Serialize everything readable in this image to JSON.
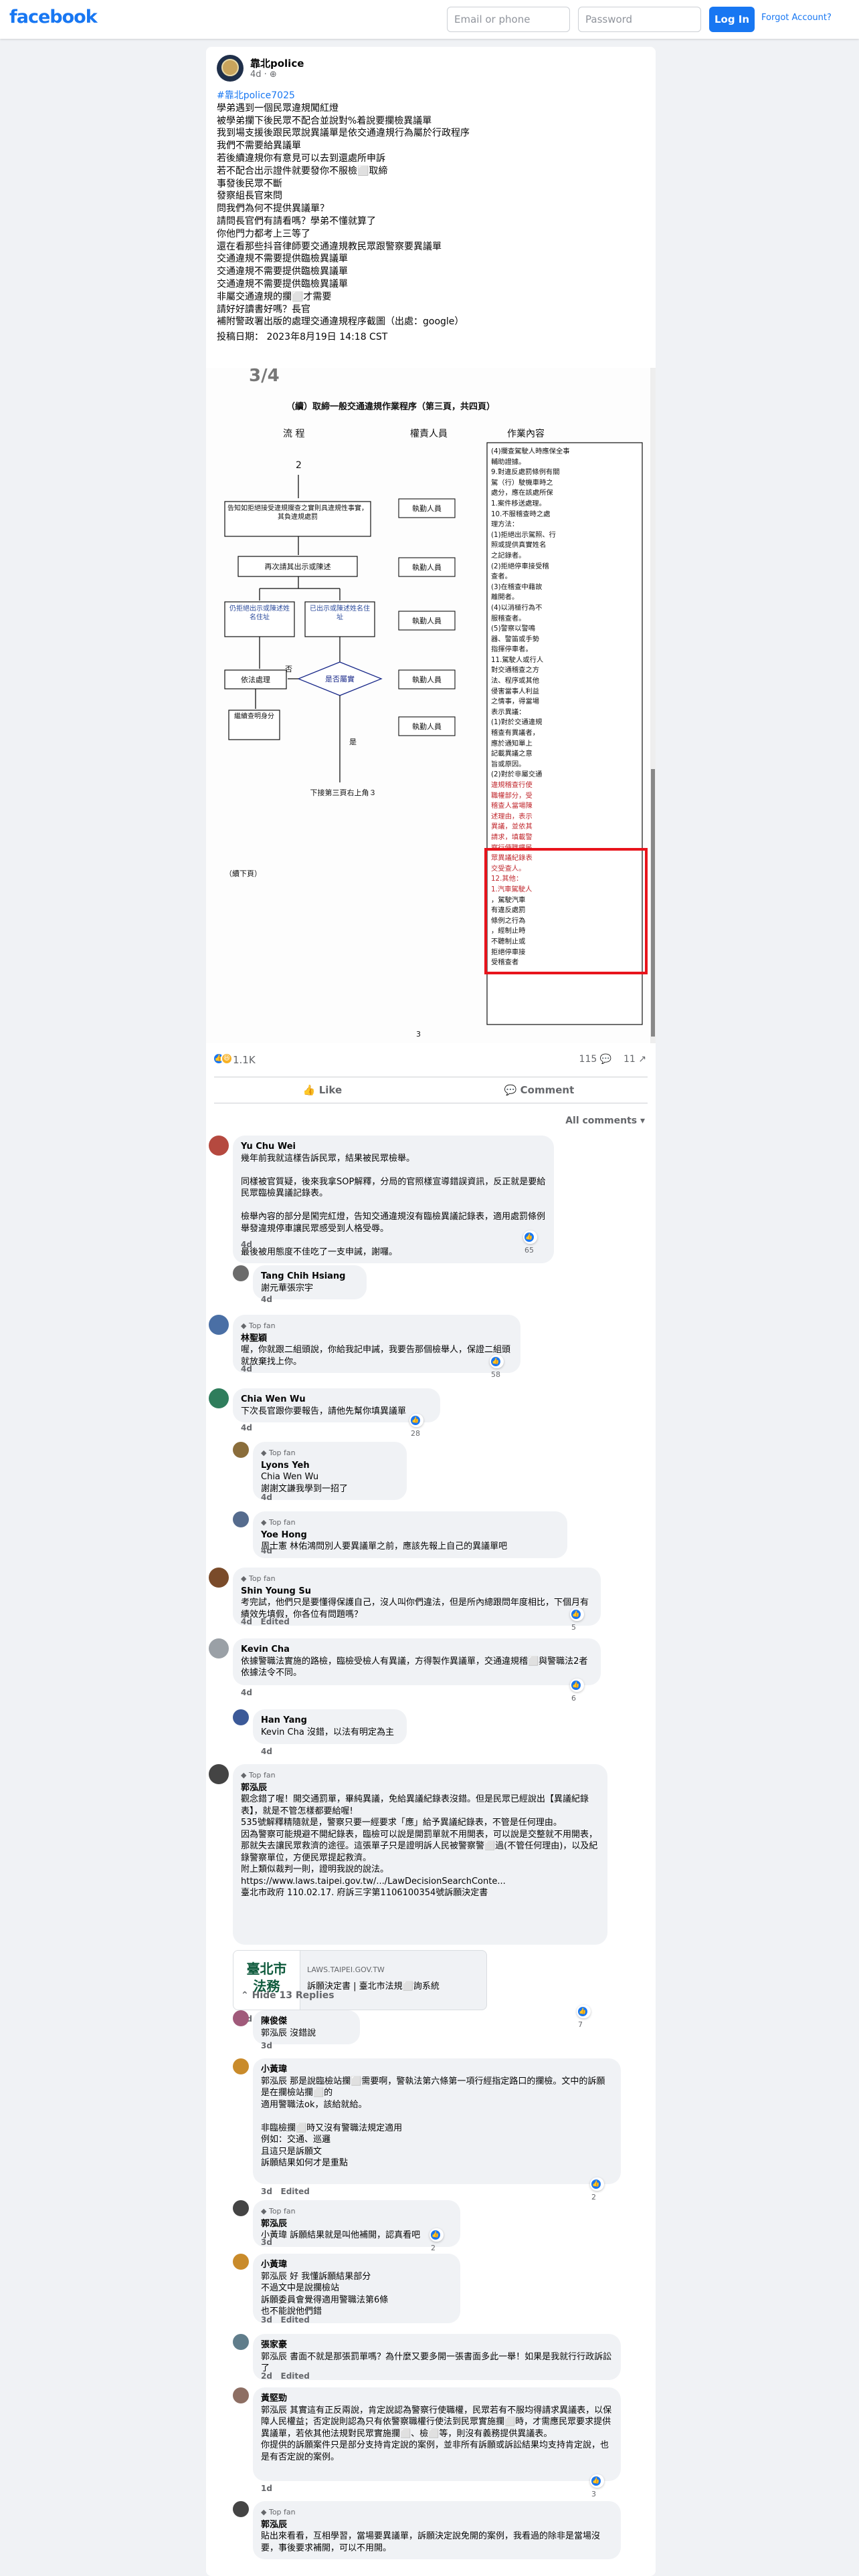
{
  "topbar": {
    "logo": "facebook",
    "email_placeholder": "Email or phone",
    "password_placeholder": "Password",
    "login_label": "Log In",
    "forgot_label": "Forgot Account?"
  },
  "post": {
    "author": "靠北police",
    "meta": "4d · ⊕",
    "hashtag": "#靠北police7025",
    "body": "學弟遇到一個民眾違規闖紅燈\n被學弟攔下後民眾不配合並說對%着說要攔檢異議單\n我到場支援後跟民眾說異議單是依交通違規行為屬於行政程序\n我們不需要給異議單\n若後續違規你有意見可以去到還處所申訴\n若不配合出示證件就要發你不服檢⬜取締\n事發後民眾不斷\n發察組長官來問\n問我們為何不提供異議單？\n請問長官們有請看嗎？學弟不懂就算了\n你他門力都考上三等了\n還在看那些抖音律師要交通違規教民眾跟警察要異議單\n交通違規不需要提供臨檢異議單\n交通違規不需要提供臨檢異議單\n交通違規不需要提供臨檢異議單\n非屬交通違規的攔⬜才需要\n請好好讀書好嗎？長官\n補附警政署出版的處理交通違規程序截圖（出處：google）",
    "posted_time": "投稿日期： 2023年8月19日 14:18 CST",
    "reaction_count": "1.1K",
    "comment_count": "115",
    "share_count": "11",
    "like_label": "Like",
    "comment_label": "Comment",
    "sort_label": "All comments"
  },
  "doc": {
    "page_label": "3/4",
    "title": "（續）取締一般交通違規作業程序（第三頁，共四頁）",
    "col_flow": "流  程",
    "col_resp": "權責人員",
    "col_content": "作業內容",
    "node_2": "2",
    "box_a": "告知如拒絕接受違規攔查之實則具違規性事實，其負違規處罰",
    "box_b": "再次請其出示或陳述",
    "box_c1": "仍拒絕出示或陳述姓名住址",
    "box_c2": "已出示或陳述姓名住址",
    "diamond": "是否屬實",
    "no_label": "否",
    "yes_label": "是",
    "box_d": "依法處理",
    "box_e": "繼續查明身分",
    "end_label": "下接第三頁右上角３",
    "resp1": "執勤人員",
    "resp2": "執勤人員",
    "resp3": "執勤人員",
    "resp4": "執勤人員",
    "resp5": "執勤人員",
    "continued": "（續下頁）",
    "page_num": "3",
    "content_lines": [
      "(4)攔查駕駛人時應保全事",
      "輔助證據。",
      "9.對違反處罰條例有關",
      "駕（行）駛機車時之",
      "處分，應在該處所保",
      "1.案件移送處理。",
      "10.不服稽查時之處",
      "理方法：",
      "(1)拒絕出示駕照、行",
      "照或提供真實姓名",
      "之記錄者。",
      "(2)拒絕停車接受稽",
      "查者。",
      "(3)在稽查中藉故",
      "離開者。",
      "(4)以消極行為不",
      "服稽查者。",
      "(5)警察以警鳴",
      "器、警笛或手勢",
      "指揮停車者。",
      "11.駕駛人或行人",
      "對交通稽查之方",
      "法、程序或其他",
      "侵害當事人利益",
      "之情事，得當場",
      "表示異議：",
      "(1)對於交通違規",
      "稽查有異議者，",
      "應於通知單上",
      "記載異議之意",
      "旨或原因。",
      "(2)對於非屬交通",
      "違規稽查行使",
      "職權部分，受",
      "稽查人當場陳",
      "述理由，表示",
      "異議，並依其",
      "請求，填載警",
      "察行使職權民",
      "眾異議紀錄表",
      "交受查人。",
      "12.其他：",
      "1.汽車駕駛人",
      "，駕駛汽車",
      "有違反處罰",
      "條例之行為",
      "，經制止時",
      "不聽制止或",
      "拒絕停車接",
      "受稽查者"
    ]
  },
  "comments": [
    {
      "name": "Yu Chu Wei",
      "text": "幾年前我就這樣告訴民眾，結果被民眾檢舉。\n\n同樣被官質疑，後來我拿SOP解釋，分局的官照樣宣導錯誤資訊，反正就是要給民眾臨檢異議記錄表。\n\n檢舉內容的部分是闖完紅燈，告知交通違規沒有臨檢異議記錄表，適用處罰條例舉發違規停車讓民眾感受到人格受辱。\n\n最後被用態度不佳吃了一支申誡，謝囉。",
      "time": "4d",
      "reacts": "65"
    },
    {
      "name": "Tang Chih Hsiang",
      "text": "謝元華張宗宇",
      "time": "4d"
    },
    {
      "name": "林聖穎",
      "flair": "Top fan",
      "text": "喔，你就跟二組頭說，你給我記申誡，我要告那個檢舉人，保證二組頭就放棄找上你。",
      "time": "4d",
      "reacts": "58"
    },
    {
      "name": "Chia Wen Wu",
      "text": "下次長官跟你要報告，請他先幫你填異議單",
      "time": "4d",
      "reacts": "28"
    },
    {
      "name": "Lyons Yeh",
      "flair": "Top fan",
      "text": "Chia Wen Wu\n謝謝文謙我學到一招了",
      "time": "4d"
    },
    {
      "name": "Yoe Hong",
      "flair": "Top fan",
      "text": "周士憲 林佑鴻問別人要異議單之前，應該先報上自己的異議單吧",
      "time": "4d"
    },
    {
      "name": "Shin Young Su",
      "flair": "Top fan",
      "text": "考完試，他們只是要懂得保護自己，沒人叫你們違法，但是所內總跟問年度相比，下個月有績效先填假，你各位有問題嗎？",
      "time": "4d",
      "edited": "Edited",
      "reacts": "5"
    },
    {
      "name": "Kevin Cha",
      "text": "依據警職法實施的路檢，臨檢受檢人有異議，方得製作異議單，交通違規稽⬜與警職法2者依據法令不同。",
      "time": "4d",
      "reacts": "6"
    },
    {
      "name": "Han Yang",
      "text": "Kevin Cha 沒錯，以法有明定為主",
      "time": "4d"
    },
    {
      "name": "郭泓辰",
      "flair": "Top fan",
      "text": "觀念錯了喔！開交通罰單，畢純異議，免給異議紀錄表沒錯。但是民眾已經說出【異議紀錄表】，就是不管怎樣都要給喔!\n535號解釋精隨就是，警察只要一經要求「應」給予異議紀錄表，不管是任何理由。\n因為警察可能規避不開紀錄表，臨檢可以說是開罰單就不用開表，可以說是交整就不用開表，那就失去讓民眾救濟的途徑。這張單子只是證明訴人民被警察警⬜過(不管任何理由)，以及紀錄警察單位，方便民眾提起救濟。\n附上類似裁判一則，證明我說的說法。\nhttps://www.laws.taipei.gov.tw/.../LawDecisionSearchConte...\n臺北市政府 110.02.17. 府訴三字第1106100354號訴願決定書",
      "time": "3d",
      "reacts": "7",
      "link_site": "LAWS.TAIPEI.GOV.TW",
      "link_title": "訴願決定書 | 臺北市法規⬜詢系統",
      "link_logo": "臺北市\n法務"
    },
    {
      "hide_label": "Hide 13 Replies"
    },
    {
      "name": "陳俊傑",
      "text": "郭泓辰 沒錯說",
      "time": "3d"
    },
    {
      "name": "小黃瑋",
      "text": "郭泓辰 那是說臨檢站攔⬜需要啊，警執法第六條第一項行經指定路口的攔檢。文中的訴願是在攔檢站攔⬜的\n適用警職法ok，該給就給。\n\n非臨檢攔⬜時又沒有警職法規定適用\n例如：交通、巡邏\n且這只是訴願文\n訴願結果如何才是重點",
      "time": "3d",
      "edited": "Edited",
      "reacts": "2"
    },
    {
      "name": "郭泓辰",
      "flair": "Top fan",
      "text": "小黃瑋 訴願結果就是叫他補開，認真看吧",
      "time": "3d",
      "reacts": "2"
    },
    {
      "name": "小黃瑋",
      "text": "郭泓辰 好 我懂訴願結果部分\n不過文中是說攔檢站\n訴願委員會覺得適用警職法第6條\n也不能說他們錯",
      "time": "3d",
      "edited": "Edited"
    },
    {
      "name": "張家豪",
      "text": "郭泓辰 書面不就是那張罰單嗎？為什麼又要多開一張書面多此一舉！如果是我就行行政訴訟了",
      "time": "2d",
      "edited": "Edited"
    },
    {
      "name": "黃堅勁",
      "text": "郭泓辰 其實這有正反兩說，肯定說認為警察行使職權，民眾若有不服均得請求異議表，以保障人民權益；否定說則認為只有依警察職權行使法到民眾實施攔⬜時，才需應民眾要求提供異議單，若依其他法規對民眾實施攔⬜、檢⬜等，則沒有義務提供異議表。\n你提供的訴願案件只是部分支持肯定說的案例，並非所有訴願或訴訟結果均支持肯定說，也是有否定說的案例。",
      "time": "1d",
      "reacts": "3"
    },
    {
      "name": "郭泓辰",
      "flair": "Top fan",
      "text": "貼出來看看，互相學習，當場要異議單，訴願決定說免開的案例，我看過的除非是當場沒要，事後要求補開，可以不用開。"
    }
  ]
}
